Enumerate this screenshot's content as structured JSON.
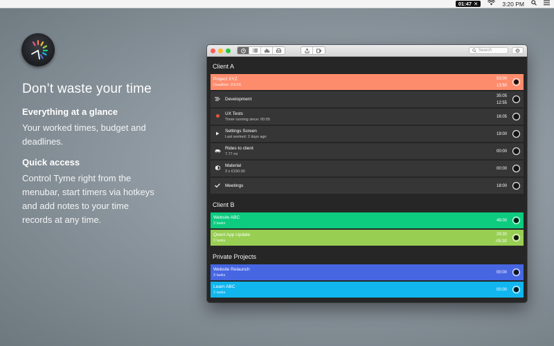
{
  "menubar": {
    "timer": "01:47",
    "timer_close": "✕",
    "clock": "3:20 PM"
  },
  "promo": {
    "headline": "Don’t waste your time",
    "section1_title": "Everything at a glance",
    "section1_text": "Your worked times, budget and deadlines.",
    "section2_title": "Quick access",
    "section2_text": "Control Tyme right from the menubar, start timers via hotkeys and add notes to your time records at any time."
  },
  "toolbar": {
    "search_placeholder": "Search"
  },
  "colors": {
    "project_xyz": "#fd8c6d",
    "website_abc": "#0dcb7f",
    "qwert_app": "#98cf53",
    "website_relaunch": "#4766e2",
    "learn_abc": "#11b6ee",
    "task_row": "#363636"
  },
  "groups": [
    {
      "title": "Client A",
      "rows": [
        {
          "name": "Project XYZ",
          "sub": "Deadline: 2/1/16",
          "time1": "53:00",
          "time2": "13:50"
        },
        {
          "name": "Development",
          "sub": "",
          "time1": "35:05",
          "time2": "12:55"
        },
        {
          "name": "UX Tests",
          "sub": "Timer running since: 00:05",
          "time1": "16:05",
          "time2": ""
        },
        {
          "name": "Settings Screen",
          "sub": "Last worked: 2 days ago",
          "time1": "19:00",
          "time2": ""
        },
        {
          "name": "Rides to client",
          "sub": "7.77 mi",
          "time1": "00:00",
          "time2": ""
        },
        {
          "name": "Material",
          "sub": "3 x €150.00",
          "time1": "00:00",
          "time2": ""
        },
        {
          "name": "Meetings",
          "sub": "",
          "time1": "18:00",
          "time2": ""
        }
      ]
    },
    {
      "title": "Client B",
      "rows": [
        {
          "name": "Website ABC",
          "sub": "3 tasks",
          "time1": "49:00",
          "time2": ""
        },
        {
          "name": "Qwert App Update",
          "sub": "3 tasks",
          "time1": "29:30",
          "time2": "-05:30"
        }
      ]
    },
    {
      "title": "Private Projects",
      "rows": [
        {
          "name": "Website Relaunch",
          "sub": "3 tasks",
          "time1": "00:00",
          "time2": ""
        },
        {
          "name": "Learn ABC",
          "sub": "2 tasks",
          "time1": "00:00",
          "time2": ""
        }
      ]
    }
  ]
}
